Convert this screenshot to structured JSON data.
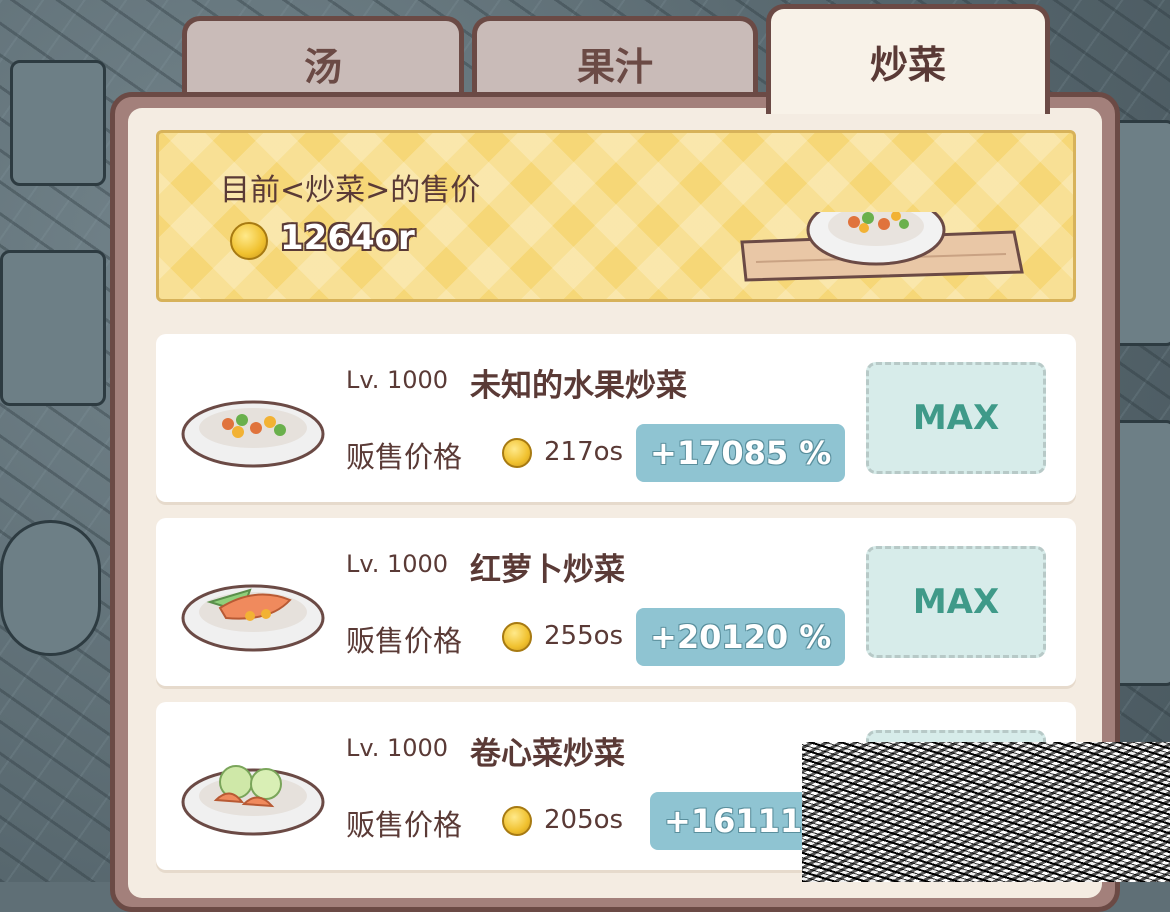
{
  "tabs": [
    {
      "label": "汤",
      "active": false
    },
    {
      "label": "果汁",
      "active": false
    },
    {
      "label": "炒菜",
      "active": true
    }
  ],
  "banner": {
    "label": "目前<炒菜>的售价",
    "price": "1264or",
    "icons": {
      "coin": "gold-coin-icon",
      "dish": "dish-on-board-icon"
    }
  },
  "recipes": [
    {
      "level_prefix": "Lv.",
      "level": "1000",
      "name": "未知的水果炒菜",
      "sell_label": "贩售价格",
      "price": "217os",
      "bonus": "+17085 %",
      "button": "MAX"
    },
    {
      "level_prefix": "Lv.",
      "level": "1000",
      "name": "红萝卜炒菜",
      "sell_label": "贩售价格",
      "price": "255os",
      "bonus": "+20120 %",
      "button": "MAX"
    },
    {
      "level_prefix": "Lv.",
      "level": "1000",
      "name": "卷心菜炒菜",
      "sell_label": "贩售价格",
      "price": "205os",
      "bonus": "+16111 %",
      "button": ""
    }
  ],
  "colors": {
    "panel_border": "#6b4a45",
    "banner_bg": "#f6d777",
    "bonus_badge": "#8fc4d2",
    "max_text": "#3f9a89"
  }
}
